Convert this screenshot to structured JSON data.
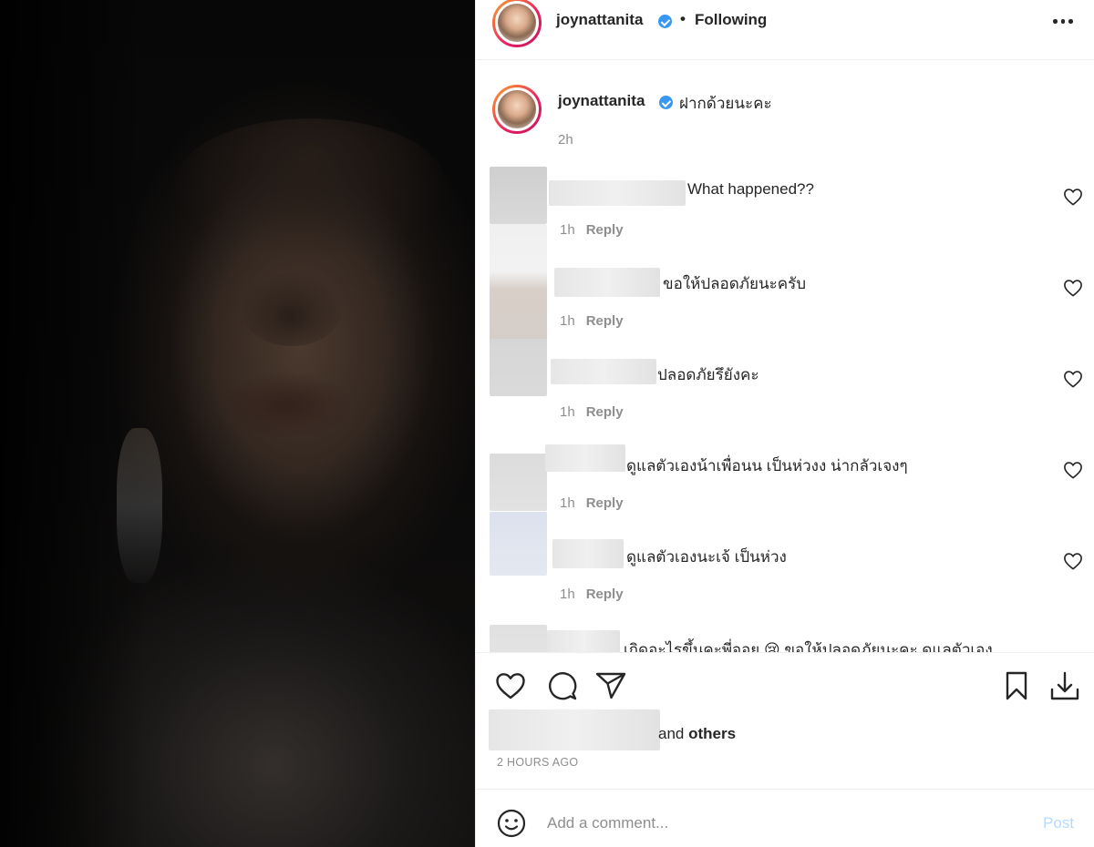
{
  "media": {
    "icon": "video-frame"
  },
  "header": {
    "username": "joynattanita",
    "separator": "•",
    "follow_status": "Following",
    "more_icon": "more-horizontal-icon"
  },
  "caption": {
    "username": "joynattanita",
    "text": "ฝากด้วยนะคะ",
    "time": "2h"
  },
  "comments": [
    {
      "text": "What happened??",
      "time": "1h",
      "reply": "Reply"
    },
    {
      "text": "ขอให้ปลอดภัยนะครับ",
      "time": "1h",
      "reply": "Reply"
    },
    {
      "text": "ปลอดภัยรึยังคะ",
      "time": "1h",
      "reply": "Reply"
    },
    {
      "text": "ดูแลตัวเองน้าเพื่อนน เป็นห่วงง น่ากลัวเจงๆ",
      "time": "1h",
      "reply": "Reply"
    },
    {
      "text": "ดูแลตัวเองนะเจ้ เป็นห่วง",
      "time": "1h",
      "reply": "Reply"
    },
    {
      "text": "เกิดอะไรขึ้นคะพี่จอย 😢 ขอให้ปลอดภัยนะคะ ดูแลตัวเอง",
      "time": "",
      "reply": ""
    }
  ],
  "actions": {
    "like_icon": "heart-icon",
    "comment_icon": "comment-icon",
    "share_icon": "share-icon",
    "save_icon": "bookmark-icon",
    "download_icon": "download-icon"
  },
  "likes": {
    "prefix": "and",
    "suffix": "others"
  },
  "posted_ago": "2 HOURS AGO",
  "add_comment": {
    "placeholder": "Add a comment...",
    "post_label": "Post",
    "emoji_icon": "emoji-icon"
  },
  "colors": {
    "verified": "#3897f0",
    "post_disabled": "#b3dbff",
    "muted": "#8e8e8e",
    "text": "#262626"
  }
}
